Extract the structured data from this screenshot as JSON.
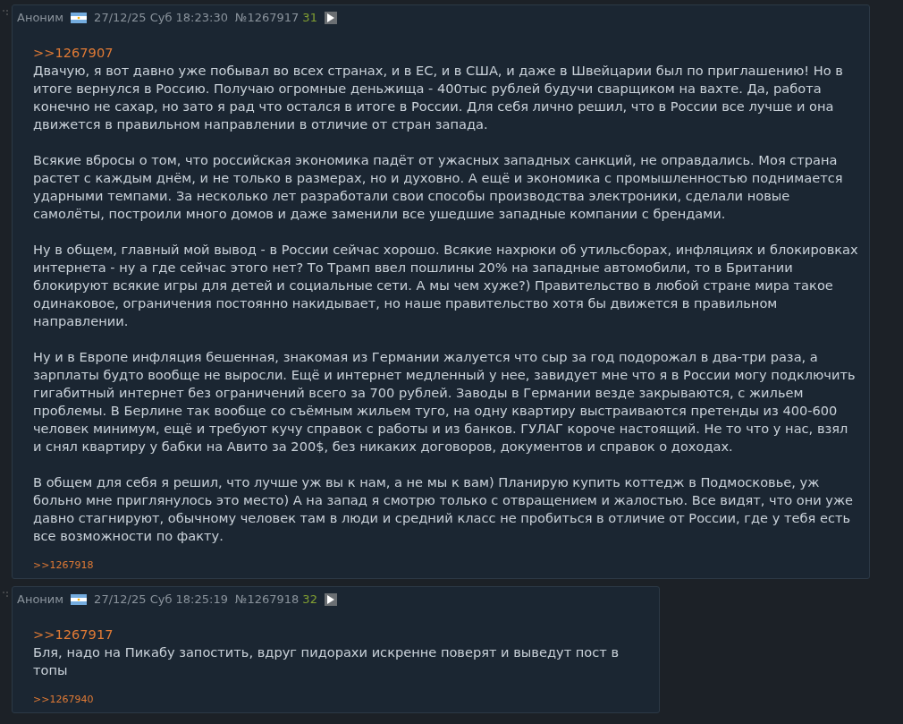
{
  "posts": [
    {
      "author": "Аноним",
      "date": "27/12/25 Суб 18:23:30",
      "number": "№1267917",
      "reply_count": "31",
      "quote": ">>1267907",
      "paragraphs": [
        "Двачую, я вот давно уже побывал во всех странах, и в ЕС, и в США, и даже в Швейцарии был по приглашению! Но в итоге вернулся в Россию. Получаю огромные деньжища - 400тыс рублей будучи сварщиком на вахте. Да, работа конечно не сахар, но зато я рад что остался в итоге в России. Для себя лично решил, что в России все лучше и она движется в правильном направлении в отличие от стран запада.",
        "Всякие вбросы о том, что российская экономика падёт от ужасных западных санкций, не оправдались. Моя страна растет с каждым днём, и не только в размерах, но и духовно. А ещё и экономика с промышленностью поднимается ударными темпами. За несколько лет разработали свои способы производства электроники, сделали новые самолёты, построили много домов и даже заменили все ушедшие западные компании с брендами.",
        "Ну в общем, главный мой вывод - в России сейчас хорошо. Всякие нахрюки об утильсборах, инфляциях и блокировках интернета - ну а где сейчас этого нет? То Трамп ввел пошлины 20% на западные автомобили, то в Британии блокируют всякие игры для детей и социальные сети. А мы чем хуже?) Правительство в любой стране мира такое одинаковое, ограничения постоянно накидывает, но наше правительство хотя бы движется в правильном направлении.",
        "Ну и в Европе инфляция бешенная, знакомая из Германии жалуется что сыр за год подорожал в два-три раза, а зарплаты будто вообще не выросли. Ещё и интернет медленный у нее, завидует мне что я в России могу подключить гигабитный интернет без ограничений всего за 700 рублей. Заводы в Германии везде закрываются, с жильем проблемы. В Берлине так вообще со съёмным жильем туго, на одну квартиру выстраиваются претенды из 400-600 человек минимум, ещё и требуют кучу справок с работы и из банков. ГУЛАГ короче настоящий. Не то что у нас, взял и снял квартиру у бабки на Авито за 200$, без никаких договоров, документов и справок о доходах.",
        "В общем для себя я решил, что лучше уж вы к нам, а не мы к вам) Планирую купить коттедж в Подмосковье, уж больно мне приглянулось это место) А на запад я смотрю только с отвращением и жалостью. Все видят, что они уже давно стагнируют, обычному человек там в люди и средний класс не пробиться в отличие от России, где у тебя есть все возможности по факту."
      ],
      "replies": [
        ">>1267918"
      ]
    },
    {
      "author": "Аноним",
      "date": "27/12/25 Суб 18:25:19",
      "number": "№1267918",
      "reply_count": "32",
      "quote": ">>1267917",
      "paragraphs": [
        "Бля, надо на Пикабу запостить, вдруг пидорахи искренне поверят и выведут пост в топы"
      ],
      "replies": [
        ">>1267940"
      ]
    }
  ]
}
